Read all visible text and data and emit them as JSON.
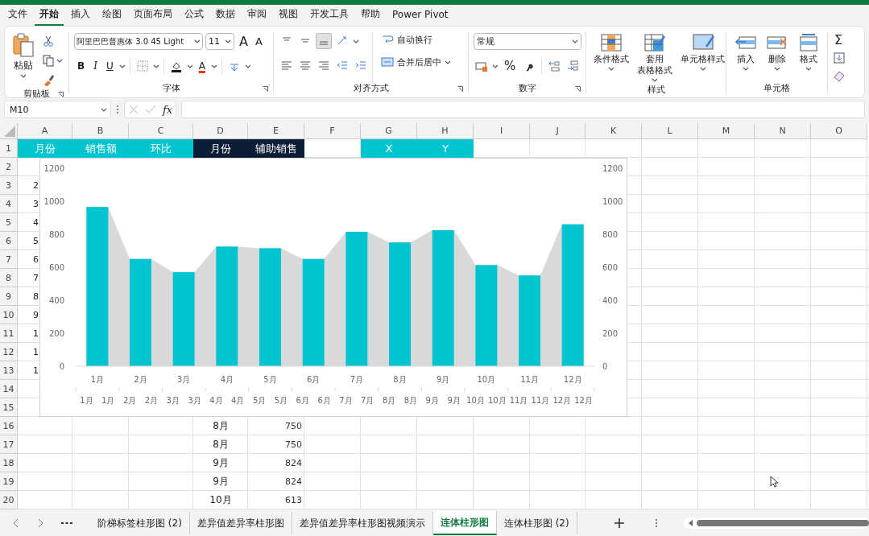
{
  "menu_tabs": [
    {
      "label": "文件",
      "selected": false
    },
    {
      "label": "开始",
      "selected": true
    },
    {
      "label": "插入",
      "selected": false
    },
    {
      "label": "绘图",
      "selected": false
    },
    {
      "label": "页面布局",
      "selected": false
    },
    {
      "label": "公式",
      "selected": false
    },
    {
      "label": "数据",
      "selected": false
    },
    {
      "label": "审阅",
      "selected": false
    },
    {
      "label": "视图",
      "selected": false
    },
    {
      "label": "开发工具",
      "selected": false
    },
    {
      "label": "帮助",
      "selected": false
    },
    {
      "label": "Power Pivot",
      "selected": false
    }
  ],
  "ribbon": {
    "groups": [
      {
        "kind": "clipboard",
        "label": "剪贴板",
        "paste": "粘贴"
      },
      {
        "kind": "font",
        "label": "字体",
        "font_name": "阿里巴巴普惠体 3.0 45 Light",
        "font_size": "11",
        "grow": "A",
        "shrink": "A",
        "bold": "B",
        "italic": "I",
        "underline": "U",
        "font_color": "A"
      },
      {
        "kind": "align",
        "label": "对齐方式",
        "valign": [
          {
            "selected": false
          },
          {
            "selected": false
          },
          {
            "selected": true
          }
        ],
        "wrap": "自动换行",
        "merge": "合并后居中"
      },
      {
        "kind": "number",
        "label": "数字",
        "format": "常规",
        "percent": "%"
      },
      {
        "kind": "big",
        "label": "样式",
        "buttons": [
          {
            "lines": [
              "条件格式"
            ]
          },
          {
            "lines": [
              "套用",
              "表格格式"
            ]
          },
          {
            "lines": [
              "单元格样式"
            ]
          }
        ]
      },
      {
        "kind": "big",
        "label": "单元格",
        "buttons": [
          {
            "lines": [
              "插入"
            ]
          },
          {
            "lines": [
              "删除"
            ]
          },
          {
            "lines": [
              "格式"
            ]
          }
        ]
      },
      {
        "kind": "editing",
        "sigma": "Σ"
      }
    ]
  },
  "formula_bar": {
    "name_box": "M10",
    "fx": "fx"
  },
  "grid": {
    "columns": [
      "A",
      "B",
      "C",
      "D",
      "E",
      "F",
      "G",
      "H",
      "I",
      "J",
      "K",
      "L",
      "M",
      "N",
      "O"
    ],
    "rows": [
      {
        "label": "1",
        "cells": {
          "A": {
            "text": "月份",
            "color": "#00c5d1"
          },
          "B": {
            "text": "销售额",
            "color": "#00c5d1"
          },
          "C": {
            "text": "环比",
            "color": "#00c5d1"
          },
          "D": {
            "text": "月份",
            "color": "#0c1e36"
          },
          "E": {
            "text": "辅助销售",
            "color": "#0c1e36"
          },
          "G": {
            "text": "X",
            "color": "#00c5d1"
          },
          "H": {
            "text": "Y",
            "color": "#00c5d1"
          }
        }
      },
      {
        "label": "2"
      },
      {
        "label": "3",
        "cells": {
          "A": {
            "text": "2"
          }
        }
      },
      {
        "label": "4",
        "cells": {
          "A": {
            "text": "3"
          }
        }
      },
      {
        "label": "5",
        "cells": {
          "A": {
            "text": "4"
          }
        }
      },
      {
        "label": "6",
        "cells": {
          "A": {
            "text": "5"
          }
        }
      },
      {
        "label": "7",
        "cells": {
          "A": {
            "text": "6"
          }
        }
      },
      {
        "label": "8",
        "cells": {
          "A": {
            "text": "7"
          }
        }
      },
      {
        "label": "9",
        "cells": {
          "A": {
            "text": "8"
          }
        }
      },
      {
        "label": "10",
        "cells": {
          "A": {
            "text": "9"
          }
        }
      },
      {
        "label": "11",
        "cells": {
          "A": {
            "text": "1"
          }
        }
      },
      {
        "label": "12",
        "cells": {
          "A": {
            "text": "1"
          }
        }
      },
      {
        "label": "13",
        "cells": {
          "A": {
            "text": "1"
          }
        }
      },
      {
        "label": "14"
      },
      {
        "label": "15"
      },
      {
        "label": "16",
        "cells": {
          "D": {
            "text": "8月"
          },
          "E": {
            "text": "750"
          }
        }
      },
      {
        "label": "17",
        "cells": {
          "D": {
            "text": "8月"
          },
          "E": {
            "text": "750"
          }
        }
      },
      {
        "label": "18",
        "cells": {
          "D": {
            "text": "9月"
          },
          "E": {
            "text": "824"
          }
        }
      },
      {
        "label": "19",
        "cells": {
          "D": {
            "text": "9月"
          },
          "E": {
            "text": "824"
          }
        }
      },
      {
        "label": "20",
        "cells": {
          "D": {
            "text": "10月"
          },
          "E": {
            "text": "613"
          }
        }
      }
    ]
  },
  "chart": {
    "primary": {
      "chart_data": {
        "type": "bar",
        "categories": [
          "1月",
          "2月",
          "3月",
          "4月",
          "5月",
          "6月",
          "7月",
          "8月",
          "9月",
          "10月",
          "11月",
          "12月"
        ],
        "series": [
          {
            "color": "#00c5d1",
            "values": [
              965,
              650,
              570,
              725,
              715,
              650,
              815,
              750,
              824,
              613,
              550,
              860
            ]
          }
        ],
        "ylim": [
          0,
          1200
        ],
        "yticks": [
          0,
          200,
          400,
          600,
          800,
          1000,
          1200
        ]
      }
    },
    "secondary": {
      "chart_data": {
        "type": "area",
        "categories": [
          "1月",
          "1月",
          "2月",
          "2月",
          "3月",
          "3月",
          "4月",
          "4月",
          "5月",
          "5月",
          "6月",
          "6月",
          "7月",
          "7月",
          "8月",
          "8月",
          "9月",
          "9月",
          "10月",
          "10月",
          "11月",
          "11月",
          "12月",
          "12月"
        ],
        "series": [
          {
            "color": "#d9d9d9",
            "values": [
              965,
              965,
              650,
              650,
              570,
              570,
              725,
              725,
              715,
              715,
              650,
              650,
              815,
              815,
              750,
              750,
              824,
              824,
              613,
              613,
              550,
              550,
              860,
              860
            ]
          }
        ],
        "ylim": [
          0,
          1200
        ],
        "yticks": [
          0,
          200,
          400,
          600,
          800,
          1000,
          1200
        ]
      }
    }
  },
  "sheet_tabs": [
    {
      "label": "阶梯标签柱形图 (2)",
      "selected": false
    },
    {
      "label": "差异值差异率柱形图",
      "selected": false
    },
    {
      "label": "差异值差异率柱形图视频演示",
      "selected": false
    },
    {
      "label": "连体柱形图",
      "selected": true
    },
    {
      "label": "连体柱形图 (2)",
      "selected": false
    }
  ]
}
